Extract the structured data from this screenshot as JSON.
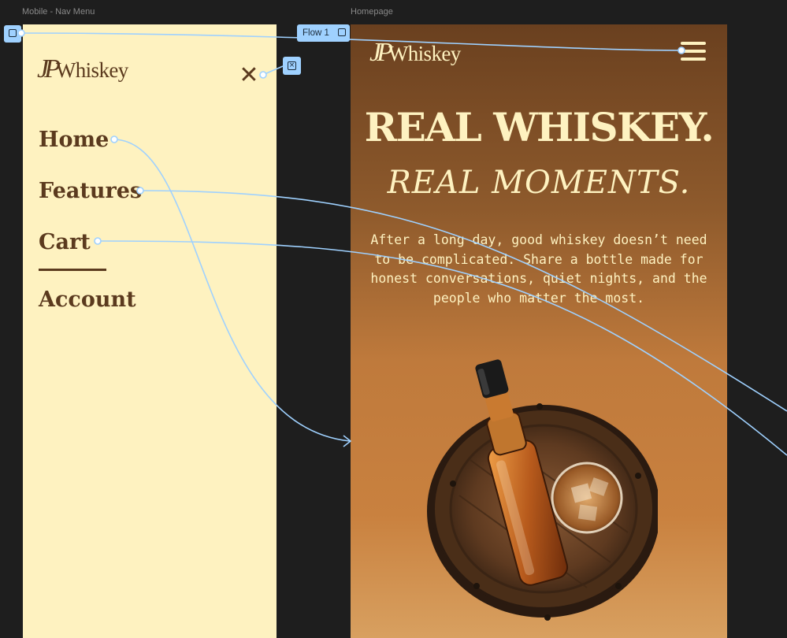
{
  "canvas": {
    "nav_frame_label": "Mobile - Nav Menu",
    "home_frame_label": "Homepage",
    "flow_label": "Flow 1"
  },
  "logo": {
    "monogram": "JP",
    "wordmark": "Whiskey"
  },
  "nav_menu": {
    "close_icon": "close-icon",
    "items": [
      {
        "label": "Home"
      },
      {
        "label": "Features"
      },
      {
        "label": "Cart",
        "active": true
      },
      {
        "label": "Account"
      }
    ]
  },
  "homepage": {
    "menu_icon": "hamburger-menu-icon",
    "headline_1": "REAL WHISKEY.",
    "headline_2": "REAL MOMENTS.",
    "intro": "After a long day, good whiskey doesn’t need to be complicated. Share a bottle made for honest conversations, quiet nights, and the people who matter the most.",
    "product_image": "whiskey-bottle-on-barrel-image"
  },
  "colors": {
    "canvas_bg": "#1e1e1e",
    "nav_bg": "#fef2c0",
    "brown": "#5b3a1e",
    "cream": "#fef2c0",
    "prototype_blue": "#9fd1ff"
  }
}
